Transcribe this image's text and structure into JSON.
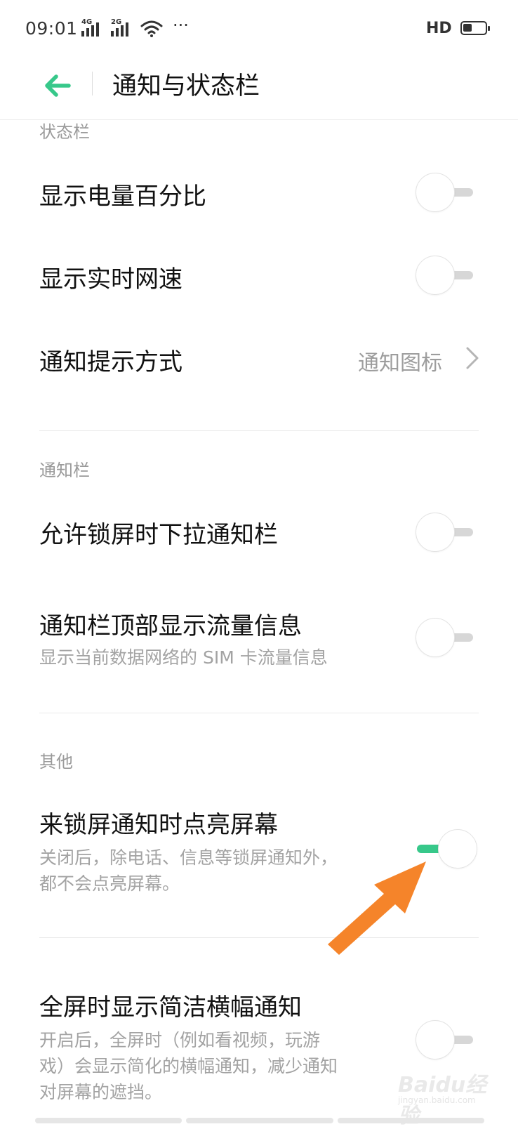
{
  "status_bar": {
    "time": "09:01",
    "network_1": "4G",
    "network_2": "2G",
    "more": "···",
    "hd": "HD",
    "battery_icon": "battery-icon"
  },
  "header": {
    "back_icon": "arrow-left-icon",
    "title": "通知与状态栏",
    "accent_color": "#37c88a"
  },
  "sections": {
    "status_bar": {
      "heading": "状态栏",
      "battery_percent": {
        "title": "显示电量百分比",
        "enabled": false
      },
      "network_speed": {
        "title": "显示实时网速",
        "enabled": false
      },
      "notify_style": {
        "title": "通知提示方式",
        "value": "通知图标"
      }
    },
    "notification_bar": {
      "heading": "通知栏",
      "lockscreen_pull": {
        "title": "允许锁屏时下拉通知栏",
        "enabled": false
      },
      "data_usage": {
        "title": "通知栏顶部显示流量信息",
        "subtitle": "显示当前数据网络的 SIM 卡流量信息",
        "enabled": false
      }
    },
    "other": {
      "heading": "其他",
      "wake_screen": {
        "title": "来锁屏通知时点亮屏幕",
        "subtitle_1": "关闭后，除电话、信息等锁屏通知外，",
        "subtitle_2": "都不会点亮屏幕。",
        "enabled": true
      },
      "banner": {
        "title": "全屏时显示简洁横幅通知",
        "subtitle_1": "开启后，全屏时（例如看视频，玩游",
        "subtitle_2": "戏）会显示简化的横幅通知，减少通知",
        "subtitle_3": "对屏幕的遮挡。",
        "enabled": false
      }
    }
  },
  "annotation": {
    "arrow_color": "#f5842a"
  },
  "watermark": {
    "text": "Baidu经验",
    "sub": "jingyan.baidu.com"
  }
}
